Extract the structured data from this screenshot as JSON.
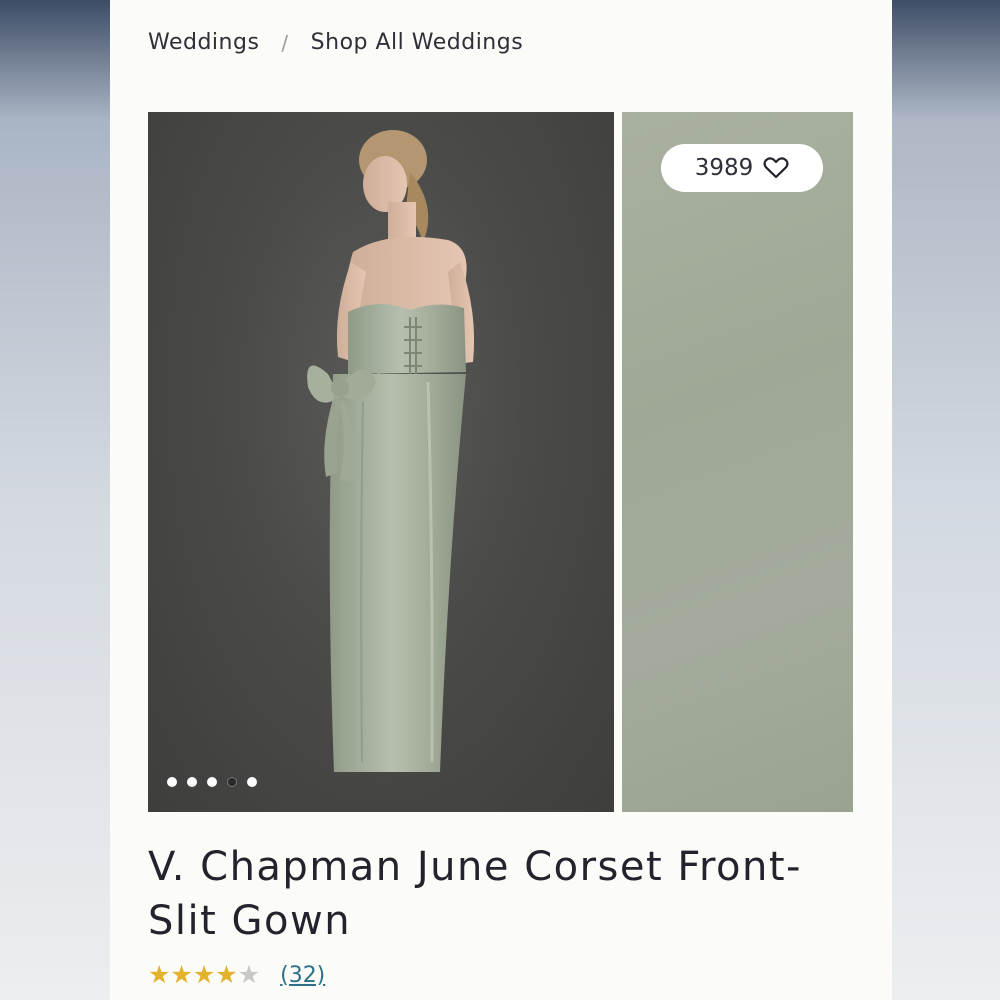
{
  "breadcrumb": {
    "items": [
      {
        "label": "Weddings"
      },
      {
        "label": "Shop All Weddings"
      }
    ],
    "separator": "/"
  },
  "gallery": {
    "main_image": "model-in-sage-strapless-gown-back-view",
    "swatch_image": "sage-fabric-swatch",
    "slide_count": 5,
    "active_slide": 4
  },
  "favorites": {
    "count": "3989",
    "icon": "heart-outline-icon"
  },
  "product": {
    "title": "V. Chapman June Corset Front-Slit Gown"
  },
  "rating": {
    "value": 4,
    "max": 5,
    "review_count_label": "(32)",
    "star_color": "#e3b32c"
  },
  "colors": {
    "gown": "#a9b3a0",
    "backdrop": "#4a4a48",
    "link": "#2e6f89"
  }
}
